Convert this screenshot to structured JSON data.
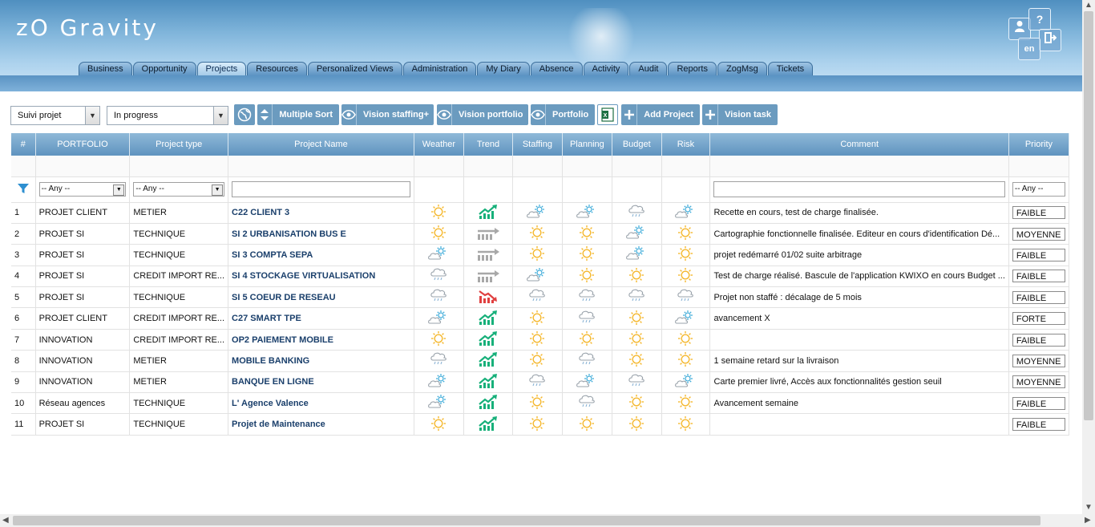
{
  "app": {
    "logo": "zO Gravity"
  },
  "header": {
    "user_icon": "user-icon",
    "help_label": "?",
    "lang": "en",
    "logout_icon": "logout-icon"
  },
  "tabs": [
    {
      "label": "Business"
    },
    {
      "label": "Opportunity"
    },
    {
      "label": "Projects",
      "active": true
    },
    {
      "label": "Resources"
    },
    {
      "label": "Personalized Views"
    },
    {
      "label": "Administration"
    },
    {
      "label": "My Diary"
    },
    {
      "label": "Absence"
    },
    {
      "label": "Activity"
    },
    {
      "label": "Audit"
    },
    {
      "label": "Reports"
    },
    {
      "label": "ZogMsg"
    },
    {
      "label": "Tickets"
    }
  ],
  "toolbar": {
    "view_select": "Suivi projet",
    "status_select": "In progress",
    "globe_icon": "globe-icon",
    "multiple_sort": "Multiple Sort",
    "vision_staffing": "Vision staffing+",
    "vision_portfolio": "Vision portfolio",
    "portfolio": "Portfolio",
    "excel_icon": "excel-icon",
    "add_project": "Add Project",
    "vision_task": "Vision task"
  },
  "columns": {
    "num": "#",
    "portfolio": "PORTFOLIO",
    "type": "Project type",
    "name": "Project Name",
    "weather": "Weather",
    "trend": "Trend",
    "staffing": "Staffing",
    "planning": "Planning",
    "budget": "Budget",
    "risk": "Risk",
    "comment": "Comment",
    "priority": "Priority"
  },
  "filters": {
    "portfolio": "-- Any --",
    "type": "-- Any --",
    "priority": "-- Any --"
  },
  "rows": [
    {
      "num": "1",
      "portfolio": "PROJET CLIENT",
      "type": "METIER",
      "name": "C22 CLIENT 3",
      "weather": "sun",
      "trend": "up",
      "staffing": "sun-cloud",
      "planning": "sun-cloud",
      "budget": "rain",
      "risk": "sun-cloud",
      "comment": "Recette en cours, test de charge finalisée.",
      "priority": "FAIBLE"
    },
    {
      "num": "2",
      "portfolio": "PROJET SI",
      "type": "TECHNIQUE",
      "name": "SI 2 URBANISATION BUS E",
      "weather": "sun",
      "trend": "flat",
      "staffing": "sun",
      "planning": "sun",
      "budget": "sun-cloud",
      "risk": "sun",
      "comment": "Cartographie fonctionnelle finalisée. Editeur en cours d'identification Dé...",
      "priority": "MOYENNE"
    },
    {
      "num": "3",
      "portfolio": "PROJET SI",
      "type": "TECHNIQUE",
      "name": "SI 3 COMPTA SEPA",
      "weather": "sun-cloud",
      "trend": "flat",
      "staffing": "sun",
      "planning": "sun",
      "budget": "sun-cloud",
      "risk": "sun",
      "comment": "projet redémarré 01/02 suite arbitrage",
      "priority": "FAIBLE"
    },
    {
      "num": "4",
      "portfolio": "PROJET SI",
      "type": "CREDIT IMPORT RE...",
      "name": "SI 4 STOCKAGE VIRTUALISATION",
      "weather": "rain",
      "trend": "flat",
      "staffing": "sun-cloud",
      "planning": "sun",
      "budget": "sun",
      "risk": "sun",
      "comment": "Test de charge réalisé. Bascule de l'application KWIXO en cours Budget ...",
      "priority": "FAIBLE"
    },
    {
      "num": "5",
      "portfolio": "PROJET SI",
      "type": "TECHNIQUE",
      "name": "SI 5 COEUR DE RESEAU",
      "weather": "rain",
      "trend": "down",
      "staffing": "rain",
      "planning": "rain",
      "budget": "rain",
      "risk": "rain",
      "comment": "Projet non staffé : décalage de 5 mois",
      "priority": "FAIBLE"
    },
    {
      "num": "6",
      "portfolio": "PROJET CLIENT",
      "type": "CREDIT IMPORT RE...",
      "name": "C27 SMART TPE",
      "weather": "sun-cloud",
      "trend": "up",
      "staffing": "sun",
      "planning": "rain",
      "budget": "sun",
      "risk": "sun-cloud",
      "comment": "avancement X",
      "priority": "FORTE"
    },
    {
      "num": "7",
      "portfolio": "INNOVATION",
      "type": "CREDIT IMPORT RE...",
      "name": "OP2 PAIEMENT MOBILE",
      "weather": "sun",
      "trend": "up",
      "staffing": "sun",
      "planning": "sun",
      "budget": "sun",
      "risk": "sun",
      "comment": "",
      "priority": "FAIBLE"
    },
    {
      "num": "8",
      "portfolio": "INNOVATION",
      "type": "METIER",
      "name": "MOBILE BANKING",
      "weather": "rain",
      "trend": "up",
      "staffing": "sun",
      "planning": "rain",
      "budget": "sun",
      "risk": "sun",
      "comment": "1 semaine retard sur la livraison",
      "priority": "MOYENNE"
    },
    {
      "num": "9",
      "portfolio": "INNOVATION",
      "type": "METIER",
      "name": "BANQUE EN LIGNE",
      "weather": "sun-cloud",
      "trend": "up",
      "staffing": "rain",
      "planning": "sun-cloud",
      "budget": "rain",
      "risk": "sun-cloud",
      "comment": "Carte premier livré, Accès aux fonctionnalités gestion seuil",
      "priority": "MOYENNE"
    },
    {
      "num": "10",
      "portfolio": "Réseau agences",
      "type": "TECHNIQUE",
      "name": "L' Agence Valence",
      "weather": "sun-cloud",
      "trend": "up",
      "staffing": "sun",
      "planning": "rain",
      "budget": "sun",
      "risk": "sun",
      "comment": "Avancement semaine",
      "priority": "FAIBLE"
    },
    {
      "num": "11",
      "portfolio": "PROJET SI",
      "type": "TECHNIQUE",
      "name": "Projet de Maintenance",
      "weather": "sun",
      "trend": "up",
      "staffing": "sun",
      "planning": "sun",
      "budget": "sun",
      "risk": "sun",
      "comment": "",
      "priority": "FAIBLE"
    }
  ],
  "colors": {
    "sun": "#f5b82e",
    "cloud": "#9aa3ab",
    "rain": "#8ab3d4",
    "trend_up": "#17b07a",
    "trend_down": "#e04040",
    "trend_flat": "#a8a8a8",
    "header_blue": "#6b9bbf"
  }
}
